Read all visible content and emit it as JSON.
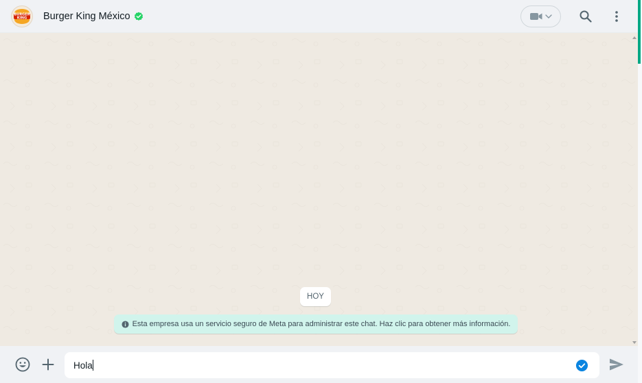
{
  "header": {
    "contact_name": "Burger King México",
    "avatar_text_top": "BURGER",
    "avatar_text_bottom": "KING",
    "verified": true
  },
  "chat": {
    "date_label": "HOY",
    "info_message": "Esta empresa usa un servicio seguro de Meta para administrar este chat. Haz clic para obtener más información."
  },
  "composer": {
    "value": "Hola"
  },
  "icons": {
    "verified": "verified-badge-icon",
    "video": "video-camera-icon",
    "chevron": "chevron-down-icon",
    "search": "search-icon",
    "menu": "kebab-menu-icon",
    "info": "info-icon",
    "emoji": "emoji-icon",
    "attach": "plus-icon",
    "check": "check-circle-icon",
    "send": "send-icon"
  },
  "colors": {
    "accent": "#00a884",
    "chat_bg": "#efeae2",
    "header_bg": "#f0f2f5",
    "info_banner_bg": "#d1f4ec",
    "verified": "#25d366",
    "check_blue": "#0a84e0"
  }
}
